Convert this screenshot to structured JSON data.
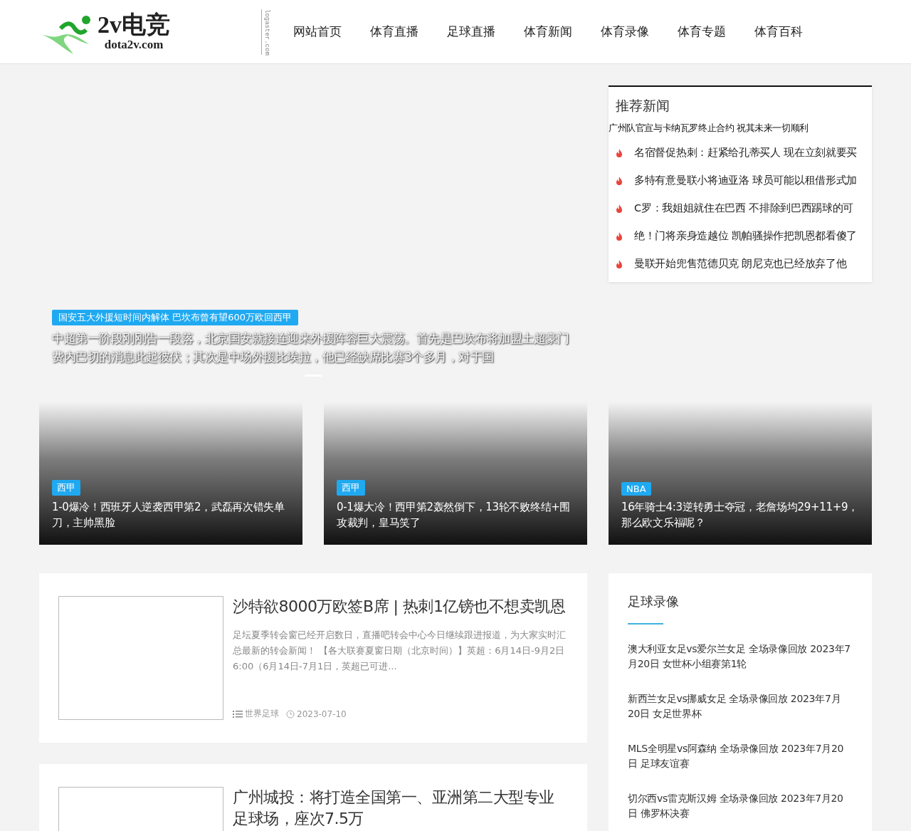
{
  "header": {
    "logo": {
      "name": "2v电竞",
      "domain": "dota2v.com",
      "credit": "logaster.com"
    },
    "nav": [
      {
        "label": "网站首页"
      },
      {
        "label": "体育直播"
      },
      {
        "label": "足球直播"
      },
      {
        "label": "体育新闻"
      },
      {
        "label": "体育录像"
      },
      {
        "label": "体育专题"
      },
      {
        "label": "体育百科"
      }
    ]
  },
  "slider": {
    "tag": "国安五大外援短时间内解体 巴坎布曾有望600万欧回西甲",
    "excerpt": "中超第一阶段刚刚告一段落，北京国安就接连迎来外援阵容巨大震荡。首先是巴坎布将加盟土超豪门费内巴切的消息此起彼伏；其次是中场外援比埃拉，他已经缺席比赛3个多月，对于国"
  },
  "recommended": {
    "title": "推荐新闻",
    "items": [
      {
        "kind": "plain",
        "text": "广州队官宣与卡纳瓦罗终止合约 祝其未来一切顺利"
      },
      {
        "kind": "hot",
        "text": "名宿督促热刺：赶紧给孔蒂买人 现在立刻就要买"
      },
      {
        "kind": "hot",
        "text": "多特有意曼联小将迪亚洛 球员可能以租借形式加"
      },
      {
        "kind": "hot",
        "text": "C罗：我姐姐就住在巴西 不排除到巴西踢球的可"
      },
      {
        "kind": "hot",
        "text": "绝！门将亲身造越位 凯帕骚操作把凯恩都看傻了"
      },
      {
        "kind": "hot",
        "text": "曼联开始兜售范德贝克 朗尼克也已经放弃了他"
      }
    ]
  },
  "featured": [
    {
      "tag": "西甲",
      "title": "1-0爆冷！西班牙人逆袭西甲第2，武磊再次错失单刀，主帅黑脸"
    },
    {
      "tag": "西甲",
      "title": "0-1爆大冷！西甲第2轰然倒下，13轮不败终结+围攻裁判，皇马笑了"
    },
    {
      "tag": "NBA",
      "title": "16年骑士4:3逆转勇士夺冠，老詹场均29+11+9，那么欧文乐福呢？"
    }
  ],
  "articles": [
    {
      "title": "沙特欲8000万欧签B席 | 热刺1亿镑也不想卖凯恩",
      "summary": "足坛夏季转会窗已经开启数日，直播吧转会中心今日继续跟进报道，为大家实时汇总最新的转会新闻！ 【各大联赛夏窗日期（北京时间）】英超：6月14日-9月2日6:00（6月14日-7月1日，英超已可进...",
      "category": "世界足球",
      "date": "2023-07-10"
    },
    {
      "title": "广州城投：将打造全国第一、亚洲第二大型专业足球场，座次7.5万"
    }
  ],
  "football_videos": {
    "title": "足球录像",
    "items": [
      {
        "text": "澳大利亚女足vs爱尔兰女足 全场录像回放 2023年7月20日 女世杯小组赛第1轮"
      },
      {
        "text": "新西兰女足vs挪威女足 全场录像回放 2023年7月20日 女足世界杯"
      },
      {
        "text": "MLS全明星vs阿森纳 全场录像回放 2023年7月20日 足球友谊赛"
      },
      {
        "text": "切尔西vs雷克斯汉姆 全场录像回放 2023年7月20日 佛罗杯决赛"
      }
    ]
  }
}
